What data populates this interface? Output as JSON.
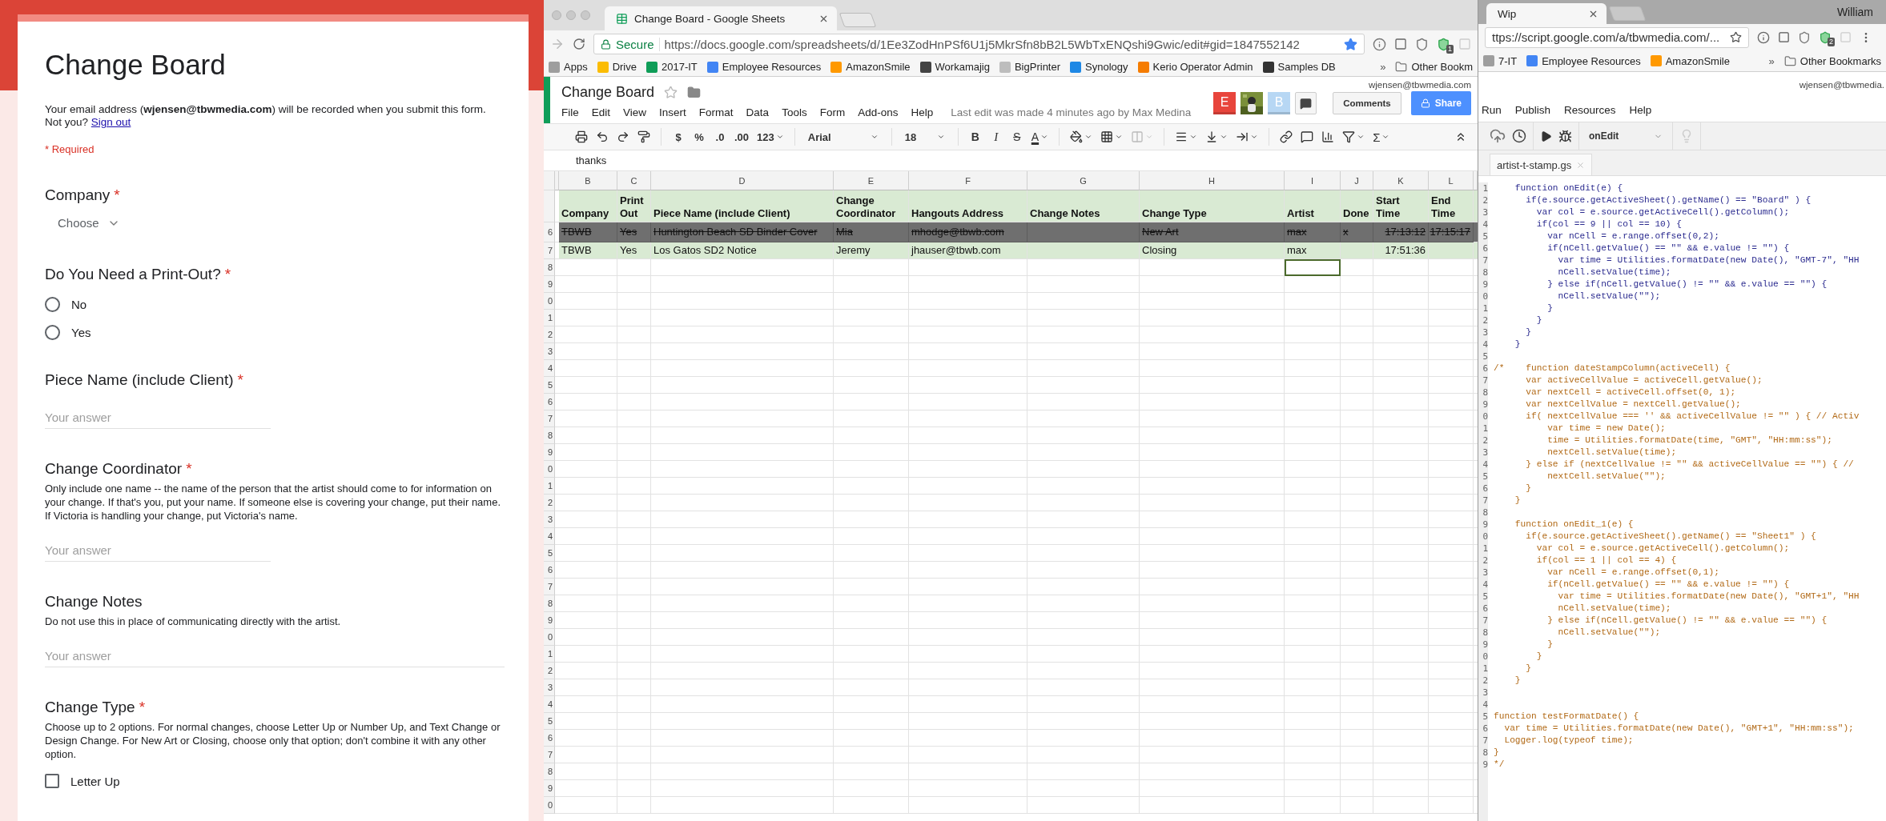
{
  "form": {
    "title": "Change Board",
    "email_notice": "Your email address (**wjensen@tbwmedia.com**) will be recorded when you submit this form. Not you?",
    "sign_out": "Sign out",
    "required_note": "* Required",
    "required_mark": "*",
    "questions": [
      {
        "kind": "dropdown",
        "title": "Company",
        "required": true,
        "value": "Choose"
      },
      {
        "kind": "radio",
        "title": "Do You Need a Print-Out?",
        "required": true,
        "options": [
          {
            "label": "No",
            "selected": false
          },
          {
            "label": "Yes",
            "selected": false
          }
        ]
      },
      {
        "kind": "short",
        "title": "Piece Name (include Client)",
        "required": true,
        "placeholder": "Your answer"
      },
      {
        "kind": "short",
        "title": "Change Coordinator",
        "required": true,
        "description": "Only include one name -- the name of the person that the artist should come to for information on your change. If that's you, put your name. If someone else is covering your change, put their name. If Victoria is handling your change, put Victoria's name.",
        "placeholder": "Your answer"
      },
      {
        "kind": "long",
        "title": "Change Notes",
        "required": false,
        "description": "Do not use this in place of communicating directly with the artist.",
        "placeholder": "Your answer"
      },
      {
        "kind": "checkbox",
        "title": "Change Type",
        "required": true,
        "description": "Choose up to 2 options. For normal changes, choose Letter Up or Number Up, and Text Change or Design Change. For New Art or Closing, choose only that option; don't combine it with any other option.",
        "options": [
          {
            "label": "Letter Up",
            "checked": false
          }
        ]
      }
    ]
  },
  "sheets_window": {
    "tab_title": "Change Board - Google Sheets",
    "secure_label": "Secure",
    "url": "https://docs.google.com/spreadsheets/d/1Ee3ZodHnPSf6U1j5MkrSfn8bB2L5WbTxENQshi9Gwic/edit#gid=1847552142",
    "extension_badge": "1",
    "bookmarks": [
      {
        "label": "Apps",
        "kind": "apps"
      },
      {
        "label": "Drive",
        "kind": "drive"
      },
      {
        "label": "2017-IT",
        "kind": "sheet"
      },
      {
        "label": "Employee Resources",
        "kind": "page"
      },
      {
        "label": "AmazonSmile",
        "kind": "amazon"
      },
      {
        "label": "Workamajig",
        "kind": "tool"
      },
      {
        "label": "BigPrinter",
        "kind": "file"
      },
      {
        "label": "Synology",
        "kind": "synology"
      },
      {
        "label": "Kerio Operator Admin",
        "kind": "kerio"
      },
      {
        "label": "Samples DB",
        "kind": "grid"
      }
    ],
    "bookmarks_more": "»",
    "other_bookmarks": "Other Bookm",
    "doc_title": "Change Board",
    "account": "wjensen@tbwmedia.com",
    "menu": [
      "File",
      "Edit",
      "View",
      "Insert",
      "Format",
      "Data",
      "Tools",
      "Form",
      "Add-ons",
      "Help"
    ],
    "last_edit": "Last edit was made 4 minutes ago by Max Medina",
    "collaborators": [
      {
        "kind": "initial",
        "initial": "E",
        "color": "#e8453c"
      },
      {
        "kind": "picture"
      },
      {
        "kind": "initial",
        "initial": "B",
        "color": "#b7d7f4"
      }
    ],
    "comments_button": "Comments",
    "share_button": "Share",
    "toolbar": {
      "currency": "$",
      "percent": "%",
      "decrease_decimals": ".0",
      "increase_decimals": ".00",
      "more_formats": "123",
      "font": "Arial",
      "font_size": "18",
      "bold": "B",
      "italic": "I",
      "strikethrough": "S",
      "text_color": "A",
      "functions": "Σ"
    },
    "formula": "thanks",
    "sheet": {
      "columns": [
        "B",
        "C",
        "D",
        "E",
        "F",
        "G",
        "H",
        "I",
        "J",
        "K",
        "L"
      ],
      "rows": [
        {
          "kind": "header",
          "cells": [
            "Company",
            "Print Out",
            "Piece Name (include Client)",
            "Change Coordinator",
            "Hangouts Address",
            "Change Notes",
            "Change Type",
            "Artist",
            "Done",
            "Start Time",
            "End Time"
          ]
        },
        {
          "kind": "done",
          "number": "6",
          "cells": [
            "TBWB",
            "Yes",
            "Huntington Beach SD Binder Cover",
            "Mia",
            "mhodge@tbwb.com",
            null,
            "New Art",
            "max",
            "x",
            "17:13:12",
            "17:15:17"
          ]
        },
        {
          "kind": "open",
          "number": "7",
          "cells": [
            "TBWB",
            "Yes",
            "Los Gatos SD2 Notice",
            "Jeremy",
            "jhauser@tbwb.com",
            null,
            "Closing",
            "max",
            null,
            "17:51:36",
            null
          ]
        },
        {
          "kind": "blank",
          "number": "8",
          "cells": [
            {
              "selected": false
            },
            {
              "selected": false
            },
            {
              "selected": false
            },
            {
              "selected": false
            },
            {
              "selected": false
            },
            {
              "selected": false
            },
            {
              "selected": false
            },
            {
              "selected": true
            },
            {
              "selected": false
            },
            {
              "selected": false
            },
            {
              "selected": false
            }
          ]
        },
        {
          "kind": "blank",
          "number": "9"
        },
        {
          "kind": "blank",
          "number": "0"
        },
        {
          "kind": "blank",
          "number": "1"
        },
        {
          "kind": "blank",
          "number": "2"
        },
        {
          "kind": "blank",
          "number": "3"
        },
        {
          "kind": "blank",
          "number": "4"
        },
        {
          "kind": "blank",
          "number": "5"
        },
        {
          "kind": "blank",
          "number": "6"
        },
        {
          "kind": "blank",
          "number": "7"
        },
        {
          "kind": "blank",
          "number": "8"
        },
        {
          "kind": "blank",
          "number": "9"
        },
        {
          "kind": "blank",
          "number": "0"
        },
        {
          "kind": "blank",
          "number": "1"
        },
        {
          "kind": "blank",
          "number": "2"
        },
        {
          "kind": "blank",
          "number": "3"
        },
        {
          "kind": "blank",
          "number": "4"
        },
        {
          "kind": "blank",
          "number": "5"
        },
        {
          "kind": "blank",
          "number": "6"
        },
        {
          "kind": "blank",
          "number": "7"
        },
        {
          "kind": "blank",
          "number": "8"
        },
        {
          "kind": "blank",
          "number": "9"
        },
        {
          "kind": "blank",
          "number": "0"
        },
        {
          "kind": "blank",
          "number": "1"
        },
        {
          "kind": "blank",
          "number": "2"
        },
        {
          "kind": "blank",
          "number": "3"
        },
        {
          "kind": "blank",
          "number": "4"
        },
        {
          "kind": "blank",
          "number": "5"
        },
        {
          "kind": "blank",
          "number": "6"
        },
        {
          "kind": "blank",
          "number": "7"
        },
        {
          "kind": "blank",
          "number": "8"
        },
        {
          "kind": "blank",
          "number": "9"
        },
        {
          "kind": "blank",
          "number": "0"
        }
      ]
    }
  },
  "script_window": {
    "tab_title": "Wip",
    "user": "William",
    "url": "ttps://script.google.com/a/tbwmedia.com/...",
    "extension_badge": "2",
    "bookmarks": [
      {
        "label": "7-IT",
        "kind": "plain"
      },
      {
        "label": "Employee Resources",
        "kind": "page"
      },
      {
        "label": "AmazonSmile",
        "kind": "amazon"
      }
    ],
    "bookmarks_more": "»",
    "other_bookmarks": "Other Bookmarks",
    "account": "wjensen@tbwmedia.",
    "menu": [
      "Run",
      "Publish",
      "Resources",
      "Help"
    ],
    "function_select": "onEdit",
    "file_tab": "artist-t-stamp.gs",
    "lines": [
      {
        "n": "1",
        "kind": "code",
        "text": "    function onEdit(e) {"
      },
      {
        "n": "2",
        "kind": "code",
        "text": "      if(e.source.getActiveSheet().getName() == \"Board\" ) {"
      },
      {
        "n": "3",
        "kind": "code",
        "text": "        var col = e.source.getActiveCell().getColumn();"
      },
      {
        "n": "4",
        "kind": "code",
        "text": "        if(col == 9 || col == 10) {"
      },
      {
        "n": "5",
        "kind": "code",
        "text": "          var nCell = e.range.offset(0,2);"
      },
      {
        "n": "6",
        "kind": "code",
        "text": "          if(nCell.getValue() == \"\" && e.value != \"\") {"
      },
      {
        "n": "7",
        "kind": "code",
        "text": "            var time = Utilities.formatDate(new Date(), \"GMT-7\", \"HH"
      },
      {
        "n": "8",
        "kind": "code",
        "text": "            nCell.setValue(time);"
      },
      {
        "n": "9",
        "kind": "code",
        "text": "          } else if(nCell.getValue() != \"\" && e.value == \"\") {"
      },
      {
        "n": "0",
        "kind": "code",
        "text": "            nCell.setValue(\"\");"
      },
      {
        "n": "1",
        "kind": "code",
        "text": "          }"
      },
      {
        "n": "2",
        "kind": "code",
        "text": "        }"
      },
      {
        "n": "3",
        "kind": "code",
        "text": "      }"
      },
      {
        "n": "4",
        "kind": "code",
        "text": "    }"
      },
      {
        "n": "5",
        "kind": "code"
      },
      {
        "n": "6",
        "kind": "comment",
        "text": "/*    function dateStampColumn(activeCell) {"
      },
      {
        "n": "7",
        "kind": "comment",
        "text": "      var activeCellValue = activeCell.getValue();"
      },
      {
        "n": "8",
        "kind": "comment",
        "text": "      var nextCell = activeCell.offset(0, 1);"
      },
      {
        "n": "9",
        "kind": "comment",
        "text": "      var nextCellValue = nextCell.getValue();"
      },
      {
        "n": "0",
        "kind": "comment",
        "text": "      if( nextCellValue === '' && activeCellValue != \"\" ) { // Activ"
      },
      {
        "n": "1",
        "kind": "comment",
        "text": "          var time = new Date();"
      },
      {
        "n": "2",
        "kind": "comment",
        "text": "          time = Utilities.formatDate(time, \"GMT\", \"HH:mm:ss\");"
      },
      {
        "n": "3",
        "kind": "comment",
        "text": "          nextCell.setValue(time);"
      },
      {
        "n": "4",
        "kind": "comment",
        "text": "      } else if (nextCellValue != \"\" && activeCellValue == \"\") { //"
      },
      {
        "n": "5",
        "kind": "comment",
        "text": "          nextCell.setValue(\"\");"
      },
      {
        "n": "6",
        "kind": "comment",
        "text": "      }"
      },
      {
        "n": "7",
        "kind": "comment",
        "text": "    }"
      },
      {
        "n": "8",
        "kind": "comment"
      },
      {
        "n": "9",
        "kind": "comment",
        "text": "    function onEdit_1(e) {"
      },
      {
        "n": "0",
        "kind": "comment",
        "text": "      if(e.source.getActiveSheet().getName() == \"Sheet1\" ) {"
      },
      {
        "n": "1",
        "kind": "comment",
        "text": "        var col = e.source.getActiveCell().getColumn();"
      },
      {
        "n": "2",
        "kind": "comment",
        "text": "        if(col == 1 || col == 4) {"
      },
      {
        "n": "3",
        "kind": "comment",
        "text": "          var nCell = e.range.offset(0,1);"
      },
      {
        "n": "4",
        "kind": "comment",
        "text": "          if(nCell.getValue() == \"\" && e.value != \"\") {"
      },
      {
        "n": "5",
        "kind": "comment",
        "text": "            var time = Utilities.formatDate(new Date(), \"GMT+1\", \"HH"
      },
      {
        "n": "6",
        "kind": "comment",
        "text": "            nCell.setValue(time);"
      },
      {
        "n": "7",
        "kind": "comment",
        "text": "          } else if(nCell.getValue() != \"\" && e.value == \"\") {"
      },
      {
        "n": "8",
        "kind": "comment",
        "text": "            nCell.setValue(\"\");"
      },
      {
        "n": "9",
        "kind": "comment",
        "text": "          }"
      },
      {
        "n": "0",
        "kind": "comment",
        "text": "        }"
      },
      {
        "n": "1",
        "kind": "comment",
        "text": "      }"
      },
      {
        "n": "2",
        "kind": "comment",
        "text": "    }"
      },
      {
        "n": "3",
        "kind": "comment"
      },
      {
        "n": "4",
        "kind": "comment"
      },
      {
        "n": "5",
        "kind": "comment",
        "text": "function testFormatDate() {"
      },
      {
        "n": "6",
        "kind": "comment",
        "text": "  var time = Utilities.formatDate(new Date(), \"GMT+1\", \"HH:mm:ss\");"
      },
      {
        "n": "7",
        "kind": "comment",
        "text": "  Logger.log(typeof time);"
      },
      {
        "n": "8",
        "kind": "comment",
        "text": "}"
      },
      {
        "n": "9",
        "kind": "comment",
        "text": "*/"
      }
    ]
  }
}
